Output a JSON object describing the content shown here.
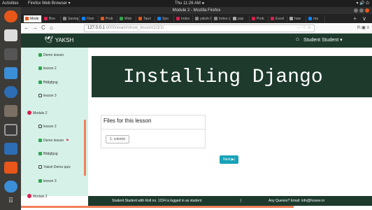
{
  "os": {
    "activities": "Activities",
    "app_menu": "Firefox Web Browser ▾",
    "clock": "Thu 11:26 AM ●",
    "tray": "▾ 🔊 ⏻"
  },
  "window": {
    "title": "Module 2 - Mozilla Firefox"
  },
  "tabs": [
    {
      "label": "Mode",
      "color": "#f5f5f5"
    },
    {
      "label": "Boo",
      "color": "#d9204e"
    },
    {
      "label": "Saving",
      "color": "#888888"
    },
    {
      "label": "Over",
      "color": "#0a84ff"
    },
    {
      "label": "Prob",
      "color": "#e8561a"
    },
    {
      "label": "Web",
      "color": "#2fa84f"
    },
    {
      "label": "Tauri",
      "color": "#e8561a"
    },
    {
      "label": "Spo",
      "color": "#0a84ff"
    },
    {
      "label": "Index",
      "color": "#d9204e"
    },
    {
      "label": "yaksh.f",
      "color": "#888888"
    },
    {
      "label": "Index.c",
      "color": "#888888"
    },
    {
      "label": "pop",
      "color": "#aaaaaa"
    },
    {
      "label": "Prob",
      "color": "#d9204e"
    },
    {
      "label": "Excel",
      "color": "#d9204e"
    },
    {
      "label": "how",
      "color": "#aaaaaa"
    },
    {
      "label": "ma",
      "color": "#0a84ff"
    }
  ],
  "toolbar": {
    "back": "←",
    "forward": "→",
    "reload": "C",
    "home": "⌂",
    "url_host": "127.0.0.1",
    "url_path": ":8000/exam/show_lesson/1/2/1/",
    "url_icons": "··· ♡ ☆",
    "right_icons": "II\\ ▣ ≡",
    "new_tab": "+",
    "tab_more": "∨"
  },
  "site": {
    "logo_text": "YAKSH",
    "home_icon": "home-icon",
    "user_menu": "Student Student ▾"
  },
  "sidebar": {
    "items": [
      {
        "label": "Demo lesson",
        "state": "checked"
      },
      {
        "label": "lesson 2",
        "state": "checked"
      },
      {
        "label": "ffddgfgsg",
        "state": "checked"
      },
      {
        "label": "lesson 3",
        "state": "unchecked"
      },
      {
        "label": "Module 2",
        "state": "module"
      },
      {
        "label": "lesson 2",
        "state": "unchecked"
      },
      {
        "label": "Demo lesson",
        "state": "current"
      },
      {
        "label": "ffddgfgsg",
        "state": "checked"
      },
      {
        "label": "Yaksh Demo quiz",
        "state": "unchecked"
      },
      {
        "label": "lesson 3",
        "state": "checked"
      },
      {
        "label": "Module 2",
        "state": "module"
      }
    ]
  },
  "lesson": {
    "banner_title": "Installing Django",
    "files_title": "Files for this lesson",
    "file_button": "1. colortst",
    "next_button": "Next ▶|"
  },
  "footer": {
    "left": "Student Student with Roll no. 1234 is logged in as student",
    "separator": "|",
    "right": "Any Queries? Email: info@fossee.in"
  },
  "colors": {
    "dark_green": "#1d3a2d",
    "sidebar_bg": "#d6f1e8",
    "accent_orange": "#f0805a",
    "next_teal": "#17a2b8"
  }
}
